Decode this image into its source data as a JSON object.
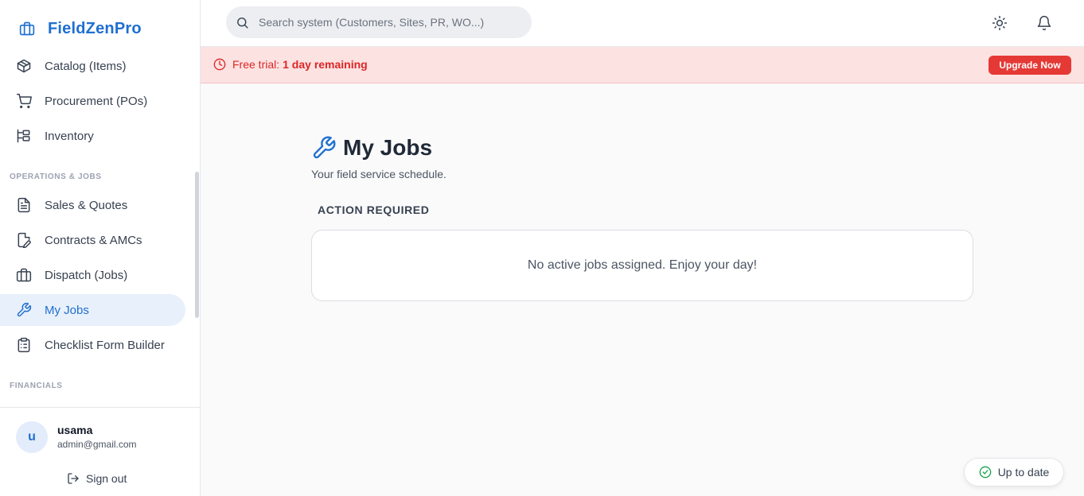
{
  "app": {
    "name": "FieldZenPro"
  },
  "sidebar": {
    "items_top": [
      {
        "label": "Catalog (Items)",
        "icon": "box-icon"
      },
      {
        "label": "Procurement (POs)",
        "icon": "cart-icon"
      },
      {
        "label": "Inventory",
        "icon": "inventory-icon"
      }
    ],
    "sections": [
      {
        "label": "OPERATIONS & JOBS"
      },
      {
        "label": "FINANCIALS"
      }
    ],
    "items_ops": [
      {
        "label": "Sales & Quotes",
        "icon": "document-icon"
      },
      {
        "label": "Contracts & AMCs",
        "icon": "contract-icon"
      },
      {
        "label": "Dispatch (Jobs)",
        "icon": "briefcase-icon"
      },
      {
        "label": "My Jobs",
        "icon": "wrench-icon",
        "active": true
      },
      {
        "label": "Checklist Form Builder",
        "icon": "clipboard-icon"
      }
    ],
    "user": {
      "initial": "u",
      "name": "usama",
      "email": "admin@gmail.com"
    },
    "signout_label": "Sign out"
  },
  "topbar": {
    "search_placeholder": "Search system (Customers, Sites, PR, WO...)"
  },
  "banner": {
    "prefix": "Free trial:",
    "highlight": "1 day remaining",
    "button_label": "Upgrade Now"
  },
  "main": {
    "title": "My Jobs",
    "subtitle": "Your field service schedule.",
    "section_heading": "ACTION REQUIRED",
    "empty_message": "No active jobs assigned. Enjoy your day!"
  },
  "status": {
    "label": "Up to date"
  },
  "colors": {
    "accent": "#1f6fd1",
    "danger": "#e53935",
    "banner_bg": "#fde2e2",
    "success": "#16a34a"
  }
}
